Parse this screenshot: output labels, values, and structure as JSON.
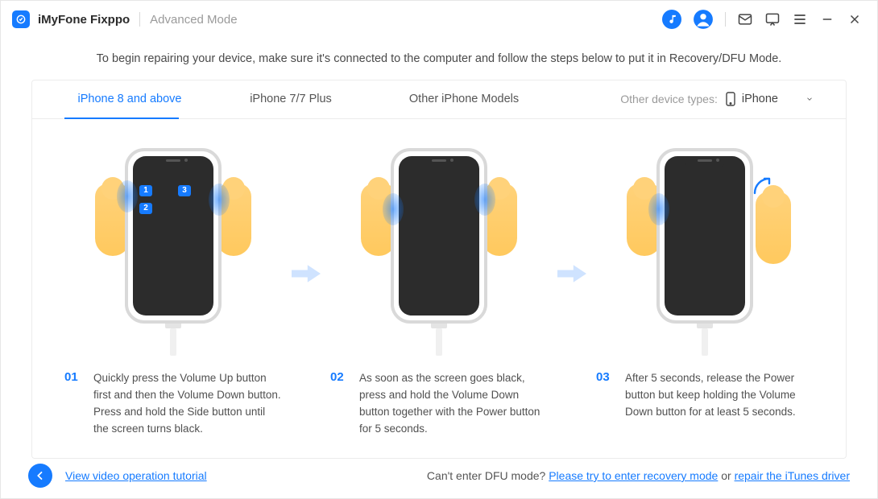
{
  "app": {
    "name": "iMyFone Fixppo",
    "mode": "Advanced Mode"
  },
  "intro": "To begin repairing your device, make sure it's connected to the computer and follow the steps below to put it in Recovery/DFU Mode.",
  "tabs": {
    "items": [
      "iPhone 8 and above",
      "iPhone 7/7 Plus",
      "Other iPhone Models"
    ],
    "active_index": 0,
    "device_type_label": "Other device types:",
    "device_type_selected": "iPhone"
  },
  "steps": [
    {
      "num": "01",
      "desc": "Quickly press the Volume Up button first and then the Volume Down button. Press and hold the Side button until the screen turns black."
    },
    {
      "num": "02",
      "desc": "As soon as the screen goes black, press and hold the Volume Down button together with the Power button for 5 seconds."
    },
    {
      "num": "03",
      "desc": "After 5 seconds, release the Power button but keep holding the Volume Down button for at least 5 seconds."
    }
  ],
  "badges": {
    "b1": "1",
    "b2": "2",
    "b3": "3"
  },
  "footer": {
    "tutorial_link": "View video operation tutorial",
    "cant_enter_prefix": "Can't enter DFU mode? ",
    "recovery_link": "Please try to enter recovery mode",
    "or": " or ",
    "itunes_link": "repair the iTunes driver"
  }
}
